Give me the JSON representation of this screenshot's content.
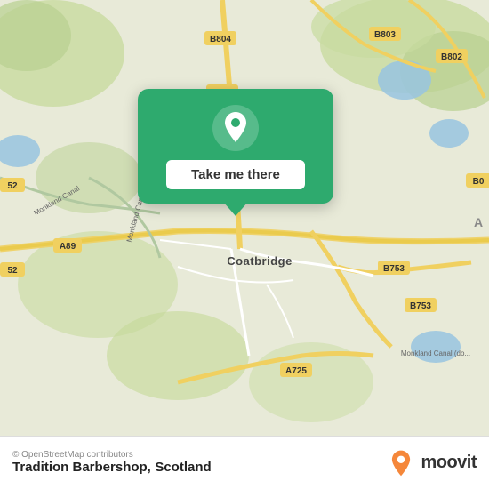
{
  "map": {
    "attribution": "© OpenStreetMap contributors",
    "background_color": "#e8ead8"
  },
  "popup": {
    "button_label": "Take me there",
    "background_color": "#2eaa6e"
  },
  "bottom_bar": {
    "place_name": "Tradition Barbershop,",
    "place_subtitle": "Scotland",
    "attribution": "© OpenStreetMap contributors",
    "logo_text": "moovit"
  },
  "road_labels": [
    "B804",
    "B804",
    "B803",
    "B802",
    "B753",
    "B753",
    "A89",
    "A725"
  ],
  "icons": {
    "pin": "📍",
    "moovit_pin_color": "#f5873a"
  }
}
